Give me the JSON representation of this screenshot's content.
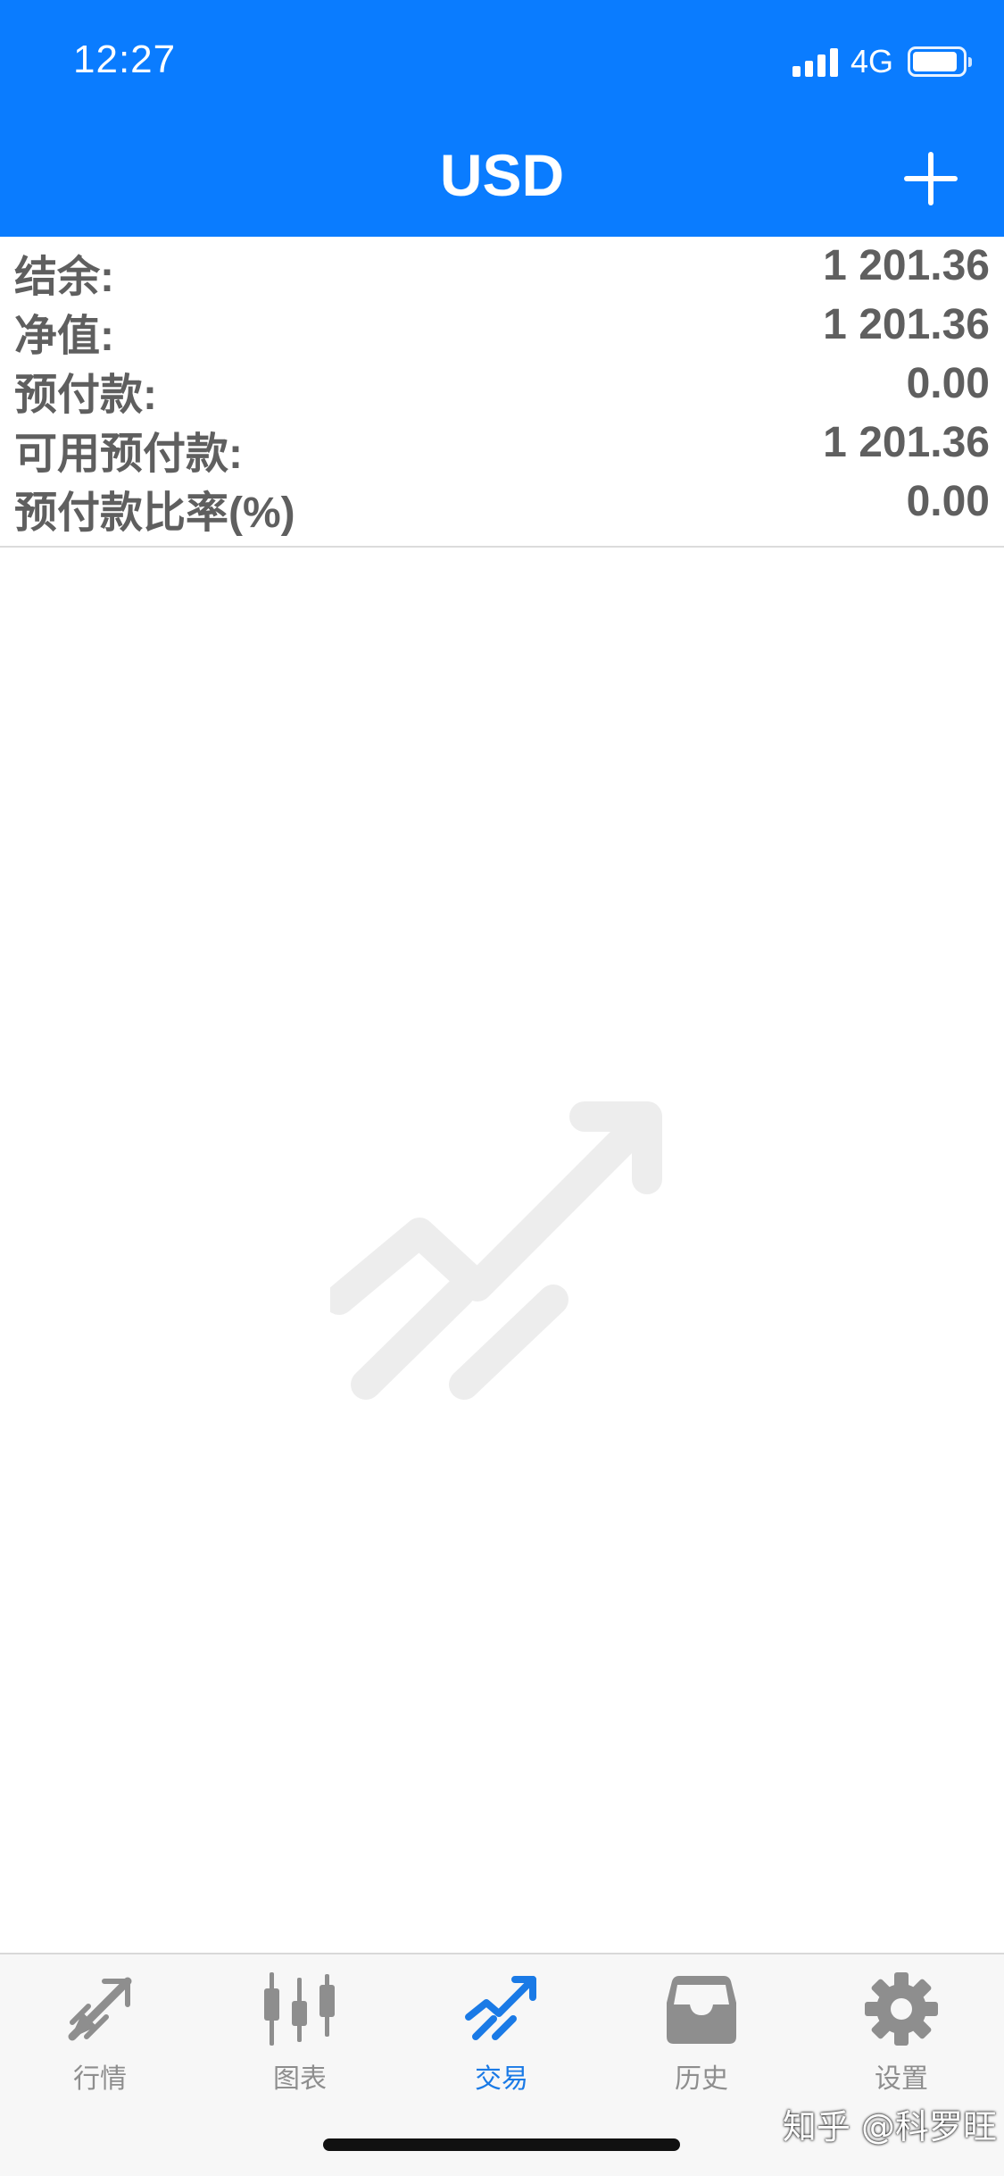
{
  "status_bar": {
    "time": "12:27",
    "network": "4G",
    "battery_level": 0.9
  },
  "header": {
    "title": "USD",
    "add_icon": "plus-icon"
  },
  "summary": {
    "rows": [
      {
        "label": "结余:",
        "value": "1 201.36"
      },
      {
        "label": "净值:",
        "value": "1 201.36"
      },
      {
        "label": "预付款:",
        "value": "0.00"
      },
      {
        "label": "可用预付款:",
        "value": "1 201.36"
      },
      {
        "label": "预付款比率(%)",
        "value": "0.00"
      }
    ]
  },
  "empty_state": {
    "icon": "trade-arrow-icon"
  },
  "tabbar": {
    "tabs": [
      {
        "label": "行情",
        "icon": "quotes-icon",
        "active": false
      },
      {
        "label": "图表",
        "icon": "candlestick-chart-icon",
        "active": false
      },
      {
        "label": "交易",
        "icon": "trade-icon",
        "active": true
      },
      {
        "label": "历史",
        "icon": "inbox-history-icon",
        "active": false
      },
      {
        "label": "设置",
        "icon": "gear-icon",
        "active": false
      }
    ]
  },
  "watermark": "知乎 @科罗旺",
  "colors": {
    "header_bg": "#0a7cff",
    "active_tab": "#1a7ae6",
    "inactive_tab": "#8e8e8e"
  }
}
